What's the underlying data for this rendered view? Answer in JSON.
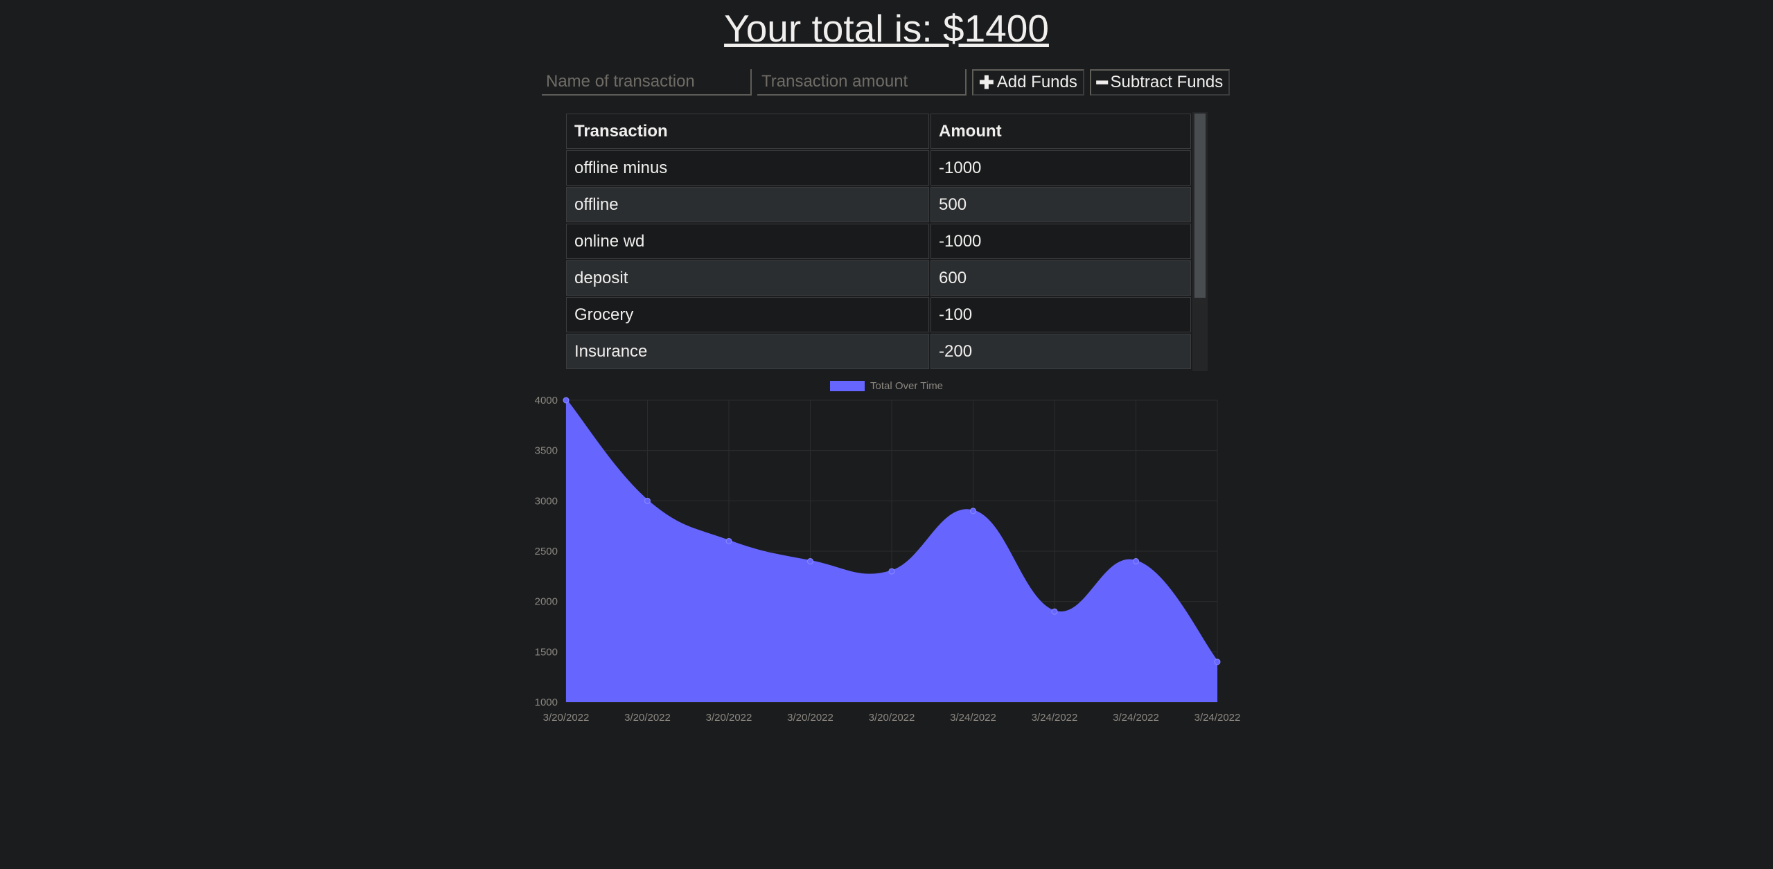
{
  "header": {
    "total_text": "Your total is: $1400"
  },
  "form": {
    "name_placeholder": "Name of transaction",
    "amount_placeholder": "Transaction amount",
    "add_label": "Add Funds",
    "subtract_label": "Subtract Funds",
    "add_icon": "plus-icon",
    "subtract_icon": "minus-icon"
  },
  "table": {
    "headers": [
      "Transaction",
      "Amount"
    ],
    "rows": [
      {
        "name": "offline minus",
        "amount": "-1000"
      },
      {
        "name": "offline",
        "amount": "500"
      },
      {
        "name": "online wd",
        "amount": "-1000"
      },
      {
        "name": "deposit",
        "amount": "600"
      },
      {
        "name": "Grocery",
        "amount": "-100"
      },
      {
        "name": "Insurance",
        "amount": "-200"
      }
    ]
  },
  "chart_data": {
    "type": "area",
    "legend": "Total Over Time",
    "legend_position": "top-center",
    "color": "#6666ff",
    "x": [
      "3/20/2022",
      "3/20/2022",
      "3/20/2022",
      "3/20/2022",
      "3/20/2022",
      "3/24/2022",
      "3/24/2022",
      "3/24/2022",
      "3/24/2022"
    ],
    "series": [
      {
        "name": "Total Over Time",
        "values": [
          4000,
          3000,
          2600,
          2400,
          2300,
          2900,
          1900,
          2400,
          1400
        ]
      }
    ],
    "ylim": [
      1000,
      4000
    ],
    "yticks": [
      4000,
      3500,
      3000,
      2500,
      2000,
      1500,
      1000
    ],
    "grid": true
  }
}
